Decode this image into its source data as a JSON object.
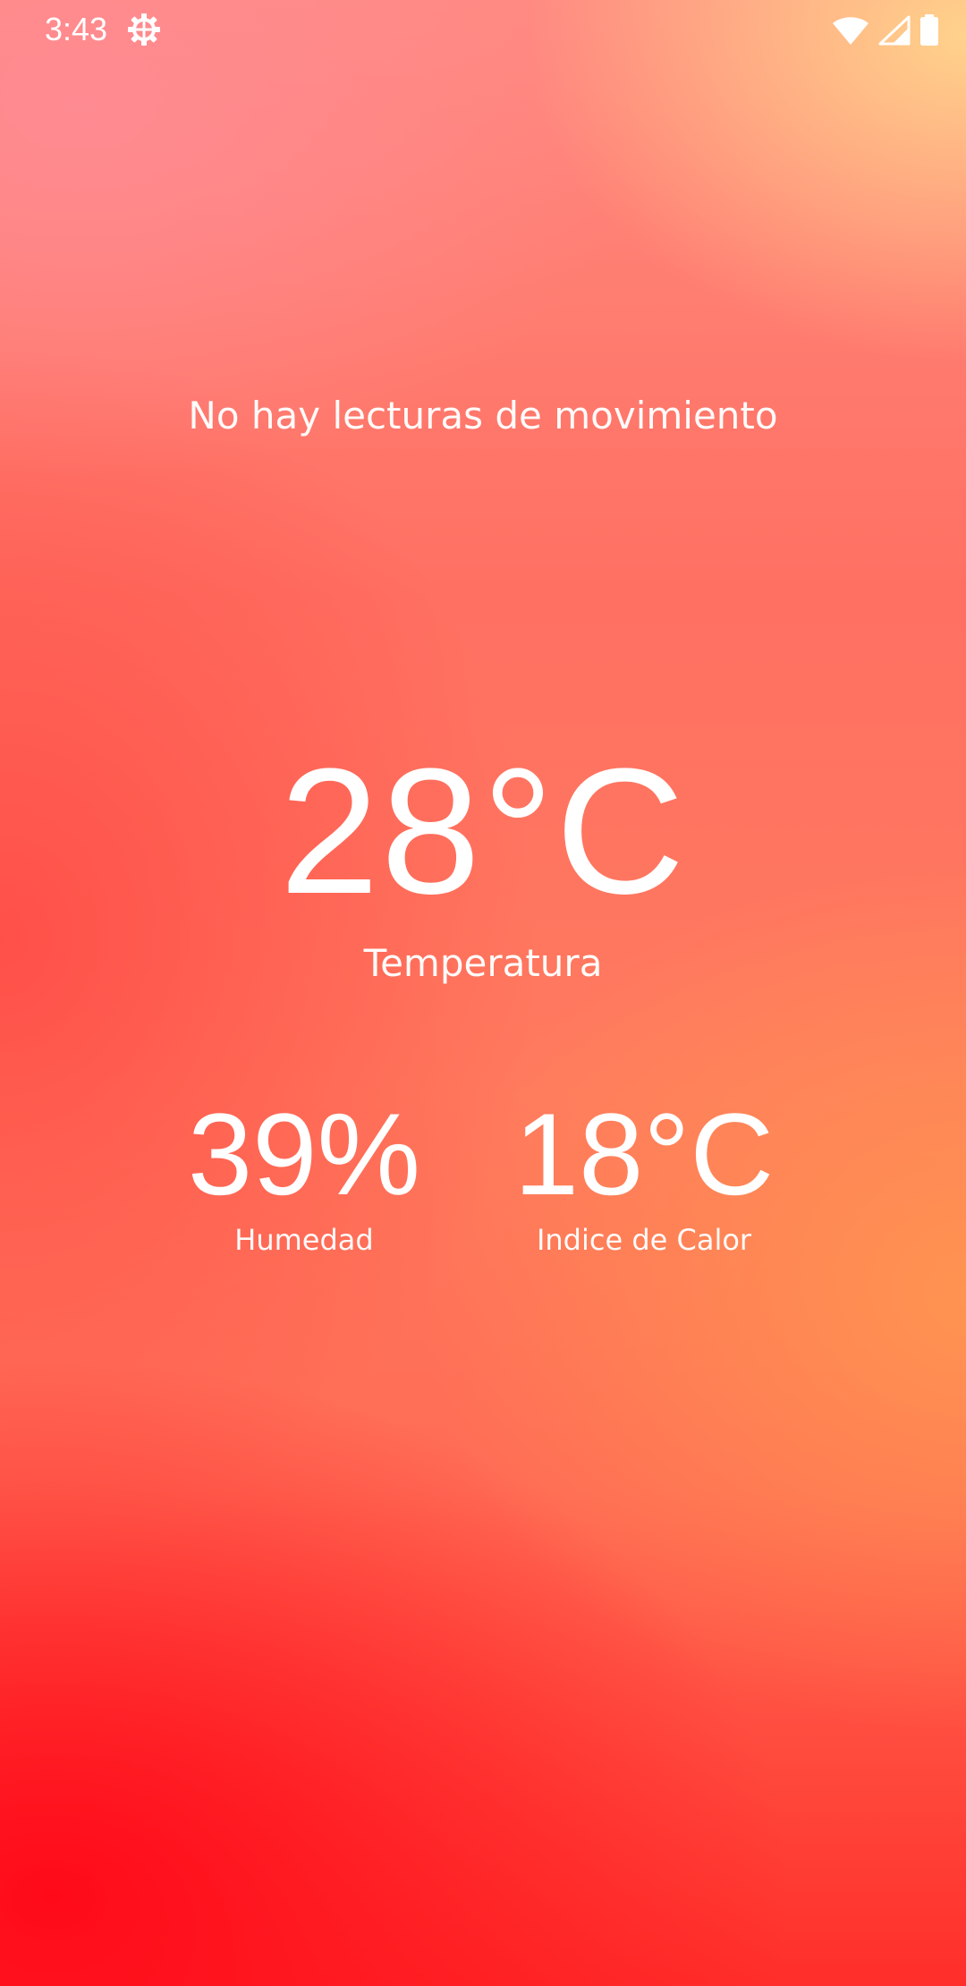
{
  "status_bar": {
    "time": "3:43",
    "icons": [
      "settings-gear-icon",
      "wifi-icon",
      "cell-signal-icon",
      "battery-icon"
    ]
  },
  "motion": {
    "message": "No hay lecturas de movimiento"
  },
  "temperature": {
    "value": "28°C",
    "label": "Temperatura"
  },
  "humidity": {
    "value": "39%",
    "label": "Humedad"
  },
  "heat_index": {
    "value": "18°C",
    "label": "Indice de Calor"
  },
  "colors": {
    "text": "#ffffff",
    "gradient_top_right": "#ffd68c",
    "gradient_bottom_left": "#ff0a19",
    "gradient_mid": "#ff7062"
  }
}
